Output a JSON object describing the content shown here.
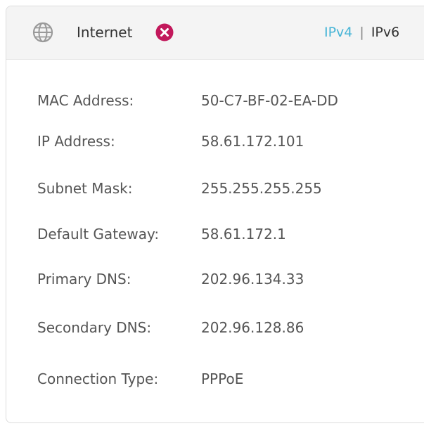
{
  "header": {
    "title": "Internet",
    "status": "disconnected",
    "icon": "globe-icon",
    "status_icon": "error-x-icon",
    "status_color": "#c2185b",
    "tabs": [
      {
        "label": "IPv4",
        "active": true
      },
      {
        "label": "IPv6",
        "active": false
      }
    ],
    "tab_separator": "|",
    "accent_color": "#45b4d6"
  },
  "details": [
    {
      "label": "MAC Address:",
      "value": "50-C7-BF-02-EA-DD"
    },
    {
      "label": "IP Address:",
      "value": "58.61.172.101"
    },
    {
      "label": "Subnet Mask:",
      "value": "255.255.255.255"
    },
    {
      "label": "Default Gateway:",
      "value": "58.61.172.1"
    },
    {
      "label": "Primary DNS:",
      "value": "202.96.134.33"
    },
    {
      "label": "Secondary DNS:",
      "value": "202.96.128.86"
    },
    {
      "label": "Connection Type:",
      "value": "PPPoE"
    }
  ]
}
